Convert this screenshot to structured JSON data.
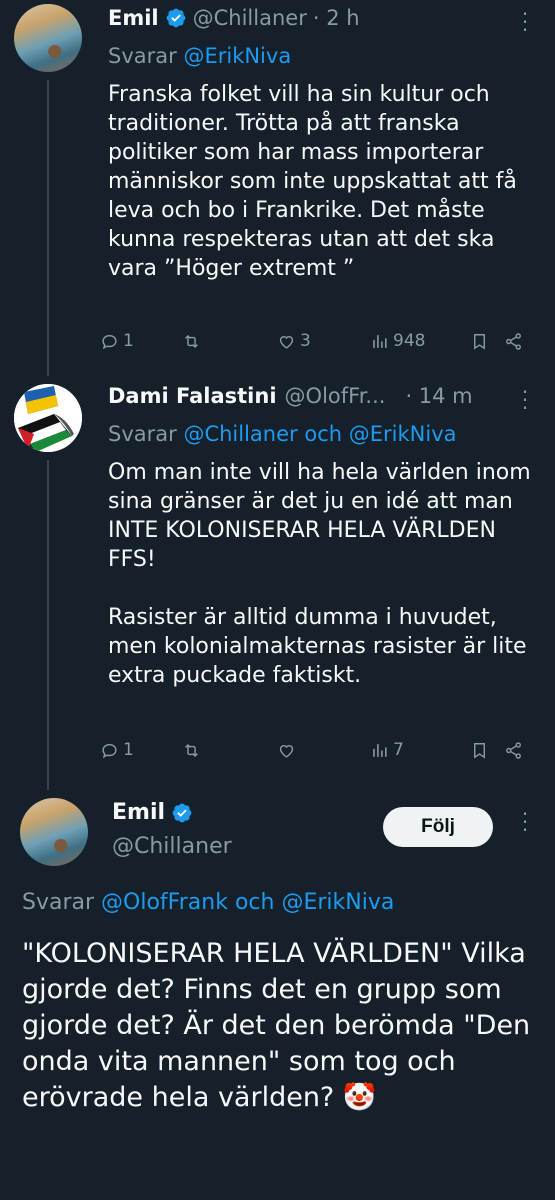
{
  "tweet1": {
    "name": "Emil",
    "handle": "@Chillaner",
    "time": "· 2 h",
    "replying_prefix": "Svarar",
    "replying_to": "@ErikNiva",
    "text": "Franska folket vill ha sin kultur och traditioner. Trötta på att franska politiker som har mass importerar människor som inte uppskattat att få leva och bo i Frankrike. Det måste kunna respekteras utan att det ska vara ”Höger extremt ”",
    "replies": "1",
    "retweets": "",
    "likes": "3",
    "views": "948"
  },
  "tweet2": {
    "name": "Dami Falastini",
    "handle": "@OlofFr...",
    "time": "· 14 m",
    "replying_prefix": "Svarar",
    "replying_to_1": "@Chillaner",
    "replying_joiner": "och",
    "replying_to_2": "@ErikNiva",
    "text": "Om man inte vill ha hela världen inom sina gränser är det ju en idé att man INTE KOLONISERAR HELA VÄRLDEN FFS!\n\nRasister är alltid dumma i huvudet, men kolonialmakternas rasister är lite extra puckade faktiskt.",
    "replies": "1",
    "retweets": "",
    "likes": "",
    "views": "7"
  },
  "main_tweet": {
    "name": "Emil",
    "handle": "@Chillaner",
    "follow_label": "Följ",
    "replying_prefix": "Svarar",
    "replying_to_1": "@OlofFrank",
    "replying_joiner": "och",
    "replying_to_2": "@ErikNiva",
    "text": "\"KOLONISERAR HELA VÄRLDEN\" Vilka gjorde det? Finns det en grupp som gjorde det? Är det den berömda \"Den onda vita mannen\" som tog och erövrade hela världen? 🤡"
  },
  "colors": {
    "background": "#15202b",
    "text": "#f7f9f9",
    "muted": "#8b98a5",
    "link": "#1d9bf0",
    "verified": "#1d9bf0",
    "follow_button": "#eff3f4"
  },
  "icons": {
    "verified": "verified-badge-icon",
    "more": "more-dots-icon",
    "reply": "reply-bubble-icon",
    "retweet": "retweet-icon",
    "like": "heart-icon",
    "views": "views-bars-icon",
    "bookmark": "bookmark-icon",
    "share": "share-icon"
  }
}
